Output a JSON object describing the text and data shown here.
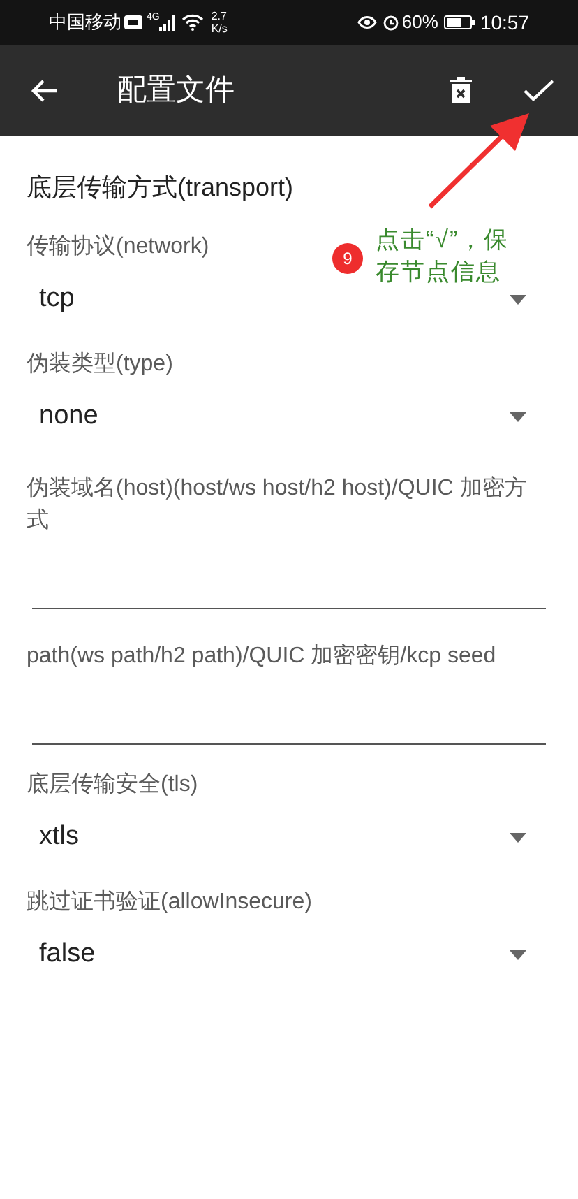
{
  "status_bar": {
    "carrier": "中国移动",
    "network": "4G",
    "speed_value": "2.7",
    "speed_unit": "K/s",
    "battery": "60%",
    "time": "10:57"
  },
  "toolbar": {
    "title": "配置文件"
  },
  "section_title": "底层传输方式(transport)",
  "fields": [
    {
      "kind": "select",
      "label": "传输协议(network)",
      "value": "tcp"
    },
    {
      "kind": "select",
      "label": "伪装类型(type)",
      "value": "none"
    },
    {
      "kind": "text",
      "label": "伪装域名(host)(host/ws host/h2 host)/QUIC 加密方式"
    },
    {
      "kind": "text",
      "label": "path(ws path/h2 path)/QUIC 加密密钥/kcp seed"
    },
    {
      "kind": "select",
      "label": "底层传输安全(tls)",
      "value": "xtls"
    },
    {
      "kind": "select",
      "label": "跳过证书验证(allowInsecure)",
      "value": "false"
    }
  ],
  "annotation": {
    "step": "9",
    "text": "点击“√”，保存节点信息"
  }
}
